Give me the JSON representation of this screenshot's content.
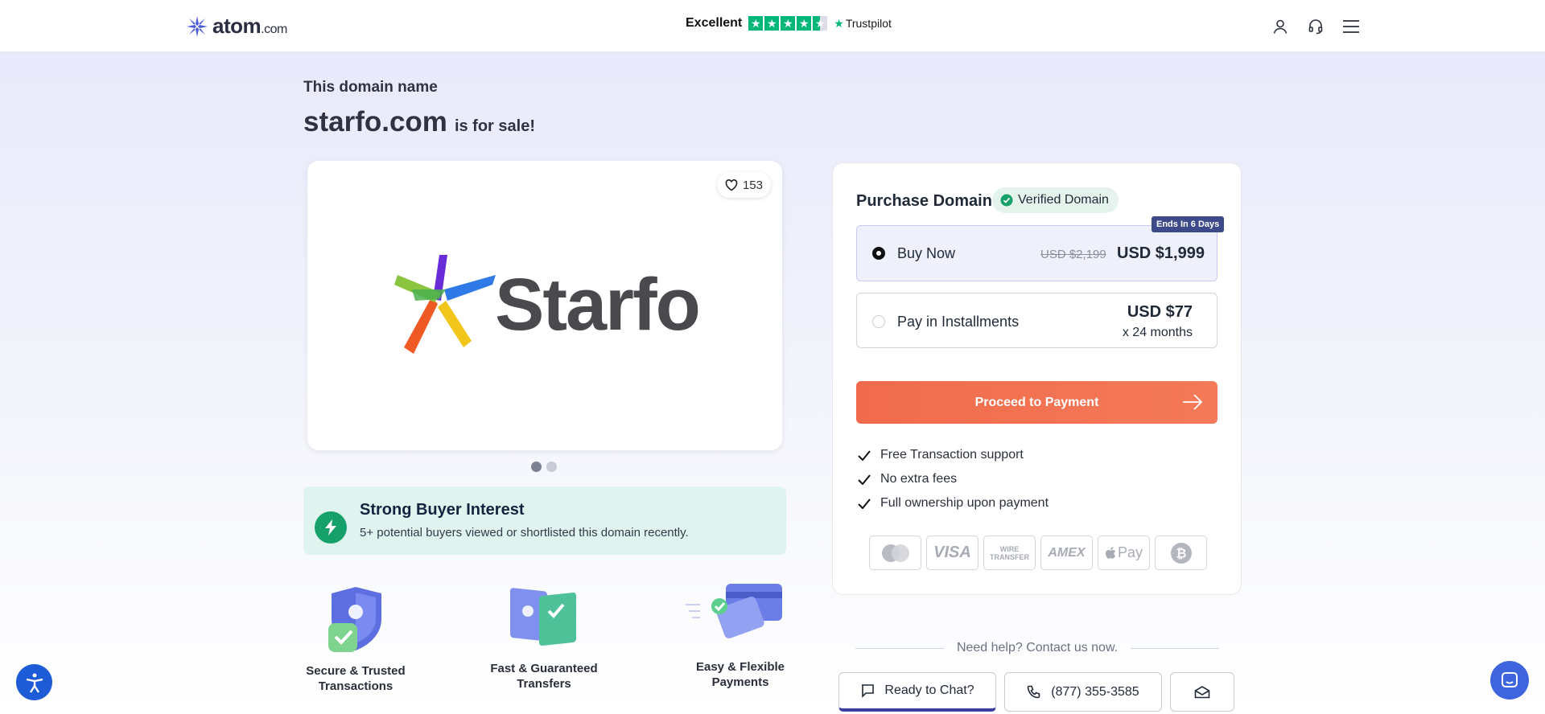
{
  "header": {
    "logo_name": "atom",
    "logo_tld": ".com",
    "trust_label": "Excellent",
    "trust_brand": "Trustpilot",
    "trust_rating": 4.5
  },
  "hero": {
    "pre_title": "This domain name",
    "domain": "starfo.com",
    "suffix": "is for sale!"
  },
  "gallery": {
    "likes": "153",
    "brand_name": "Starfo",
    "slide_count": 2,
    "active_slide": 1
  },
  "interest": {
    "title": "Strong Buyer Interest",
    "subtitle": "5+ potential buyers viewed or shortlisted this domain recently."
  },
  "features": [
    {
      "line1": "Secure & Trusted",
      "line2": "Transactions"
    },
    {
      "line1": "Fast & Guaranteed",
      "line2": "Transfers"
    },
    {
      "line1": "Easy & Flexible",
      "line2": "Payments"
    }
  ],
  "purchase": {
    "title": "Purchase Domain",
    "verified_label": "Verified Domain",
    "ends_badge": "Ends In 6 Days",
    "buy_now": {
      "label": "Buy Now",
      "old_price": "USD $2,199",
      "price": "USD $1,999",
      "selected": true
    },
    "installments": {
      "label": "Pay in Installments",
      "price": "USD $77",
      "term": "x 24 months",
      "selected": false
    },
    "proceed_label": "Proceed to Payment",
    "benefits": [
      "Free Transaction support",
      "No extra fees",
      "Full ownership upon payment"
    ],
    "payment_methods": [
      "mastercard",
      "VISA",
      "WIRE TRANSFER",
      "AMEX",
      "Pay",
      "bitcoin"
    ]
  },
  "help": {
    "label": "Need help? Contact us now.",
    "chat_label": "Ready to Chat?",
    "phone": "(877) 355-3585"
  },
  "colors": {
    "accent": "#f26f4f",
    "trust_green": "#00b67a",
    "verified_green": "#16a06a",
    "badge_navy": "#3c4a8a"
  }
}
